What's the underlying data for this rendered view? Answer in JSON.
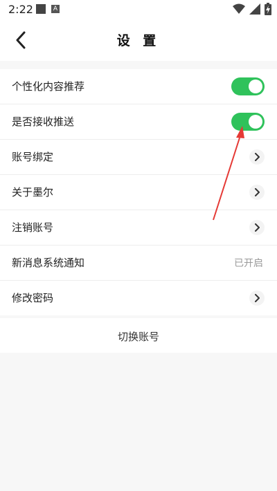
{
  "status_bar": {
    "time": "2:22",
    "icons": [
      "square-notification-icon",
      "a-notification-icon",
      "wifi-icon",
      "signal-icon",
      "battery-charging-icon"
    ]
  },
  "header": {
    "back_icon": "chevron-left-icon",
    "title": "设 置"
  },
  "settings": {
    "items": [
      {
        "label": "个性化内容推荐",
        "control": "toggle",
        "state": "on"
      },
      {
        "label": "是否接收推送",
        "control": "toggle",
        "state": "on"
      },
      {
        "label": "账号绑定",
        "control": "chevron"
      },
      {
        "label": "关于墨尔",
        "control": "chevron"
      },
      {
        "label": "注销账号",
        "control": "chevron"
      },
      {
        "label": "新消息系统通知",
        "control": "value",
        "value": "已开启"
      },
      {
        "label": "修改密码",
        "control": "chevron"
      }
    ]
  },
  "footer": {
    "switch_account_label": "切换账号"
  },
  "colors": {
    "toggle_on": "#2fc25b",
    "annotation_arrow": "#e53935"
  }
}
